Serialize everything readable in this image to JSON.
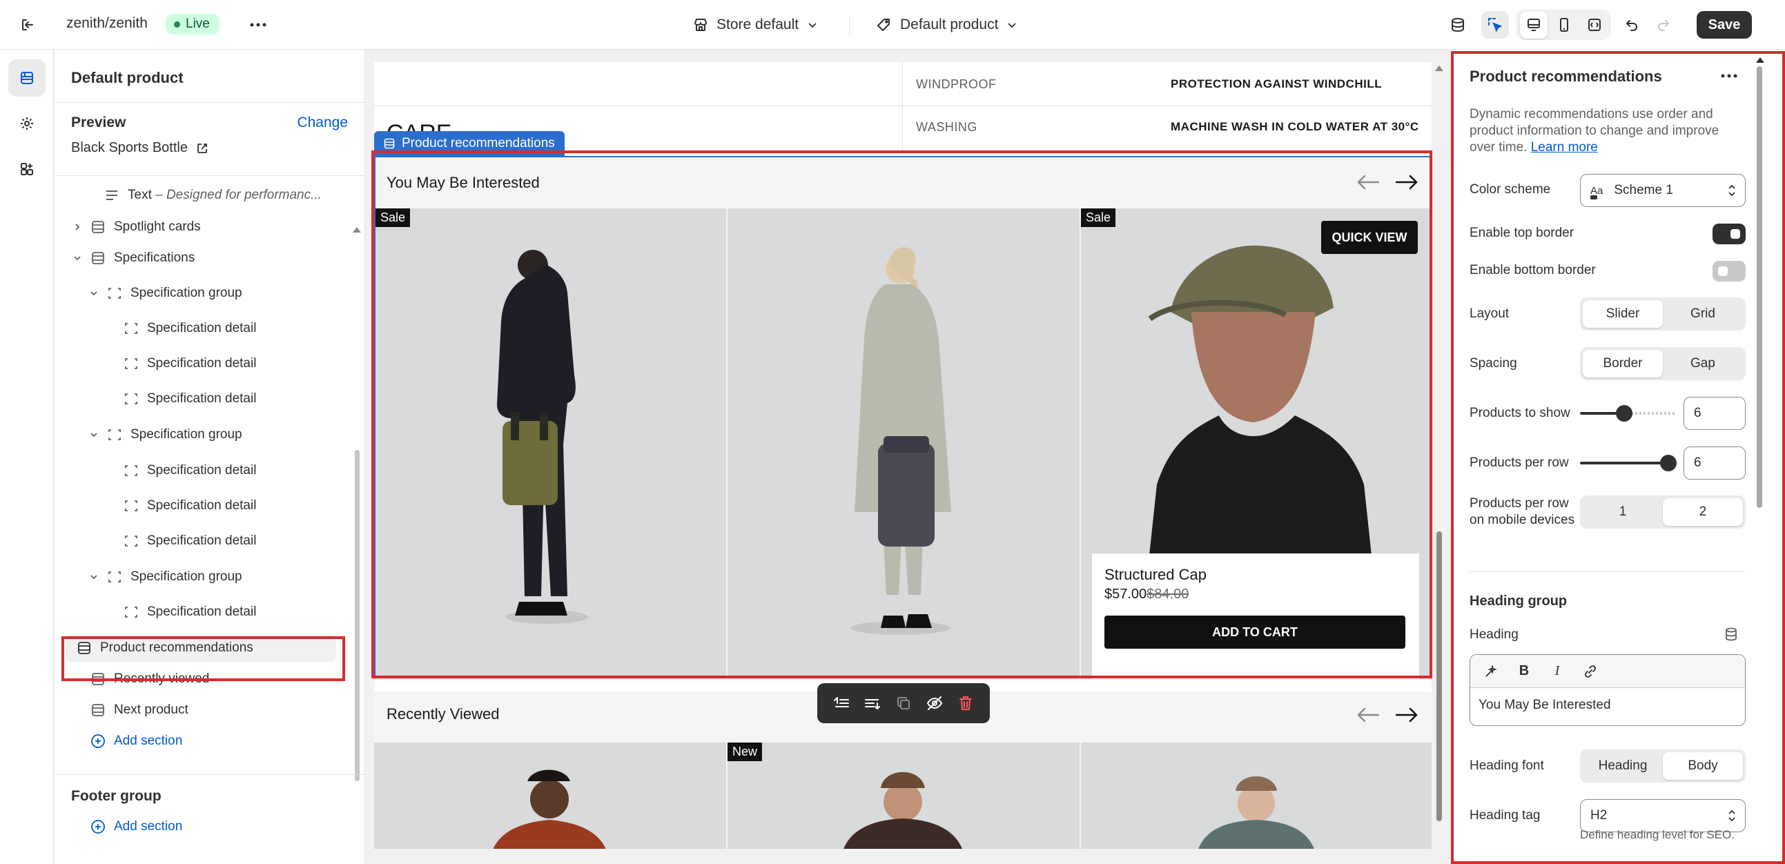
{
  "topbar": {
    "store_name": "zenith/zenith",
    "live_label": "Live",
    "theme_select": "Store default",
    "template_select": "Default product",
    "save_label": "Save"
  },
  "sidebar": {
    "title": "Default product",
    "preview_label": "Preview",
    "change_label": "Change",
    "preview_value": "Black Sports Bottle",
    "tree": [
      {
        "label": "Text",
        "sub": "– Designed for performanc..."
      },
      {
        "label": "Spotlight cards"
      },
      {
        "label": "Specifications"
      },
      {
        "label": "Specification group"
      },
      {
        "label": "Specification detail"
      },
      {
        "label": "Specification detail"
      },
      {
        "label": "Specification detail"
      },
      {
        "label": "Specification group"
      },
      {
        "label": "Specification detail"
      },
      {
        "label": "Specification detail"
      },
      {
        "label": "Specification detail"
      },
      {
        "label": "Specification group"
      },
      {
        "label": "Specification detail"
      },
      {
        "label": "Product recommendations"
      },
      {
        "label": "Recently viewed"
      },
      {
        "label": "Next product"
      },
      {
        "label": "Add section"
      }
    ],
    "footer_group_label": "Footer group",
    "footer_add_section": "Add section"
  },
  "canvas": {
    "spec_rows": [
      {
        "key": "WINDPROOF",
        "value": "PROTECTION AGAINST WINDCHILL"
      },
      {
        "key": "WASHING",
        "value": "MACHINE WASH IN COLD WATER AT 30°C"
      }
    ],
    "care_label": "CARE",
    "section_tag": "Product recommendations",
    "recs_title": "You May Be Interested",
    "sale_badge": "Sale",
    "new_badge": "New",
    "quick_view": "QUICK VIEW",
    "product_name": "Structured Cap",
    "product_price": "$57.00",
    "product_compare_price": "$84.00",
    "add_to_cart": "ADD TO CART",
    "recently_viewed_title": "Recently Viewed"
  },
  "settings": {
    "title": "Product recommendations",
    "description": "Dynamic recommendations use order and product information to change and improve over time.",
    "learn_more": "Learn more",
    "color_scheme_label": "Color scheme",
    "color_scheme_value": "Scheme 1",
    "color_scheme_swatch": "Aa",
    "enable_top_border_label": "Enable top border",
    "enable_top_border": true,
    "enable_bottom_border_label": "Enable bottom border",
    "enable_bottom_border": false,
    "layout_label": "Layout",
    "layout_options": [
      "Slider",
      "Grid"
    ],
    "layout_selected": "Slider",
    "spacing_label": "Spacing",
    "spacing_options": [
      "Border",
      "Gap"
    ],
    "spacing_selected": "Border",
    "products_to_show_label": "Products to show",
    "products_to_show": "6",
    "products_per_row_label": "Products per row",
    "products_per_row": "6",
    "products_per_row_mobile_label": "Products per row on mobile devices",
    "mobile_options": [
      "1",
      "2"
    ],
    "mobile_selected": "2",
    "heading_group_label": "Heading group",
    "heading_label": "Heading",
    "heading_value": "You May Be Interested",
    "heading_font_label": "Heading font",
    "heading_font_options": [
      "Heading",
      "Body"
    ],
    "heading_font_selected": "Body",
    "heading_tag_label": "Heading tag",
    "heading_tag_value": "H2",
    "heading_tag_help": "Define heading level for SEO."
  },
  "colors": {
    "accent_blue": "#005bd3",
    "selection_blue": "#2c6ecb",
    "highlight_red": "#d72c2c",
    "live_badge_bg": "#cdfee1"
  }
}
